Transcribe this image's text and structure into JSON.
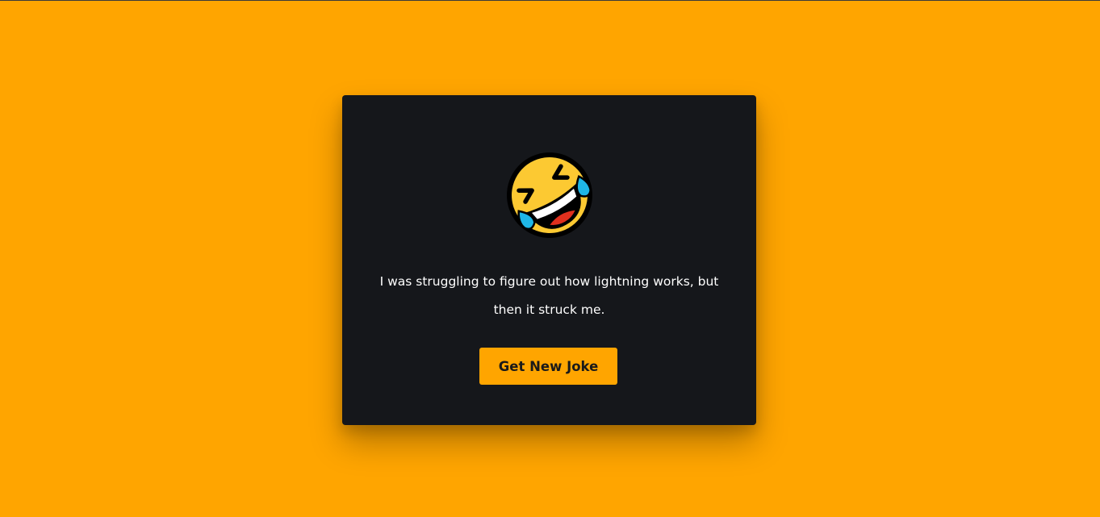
{
  "colors": {
    "background": "#ffa500",
    "card": "#15171b",
    "text": "#ffffff",
    "button_bg": "#ffa500",
    "button_text": "#1a1a1a"
  },
  "emoji": {
    "icon": "rolling-on-the-floor-laughing-icon"
  },
  "joke": {
    "text": "I was struggling to figure out how lightning works, but then it struck me."
  },
  "button": {
    "label": "Get New Joke"
  }
}
